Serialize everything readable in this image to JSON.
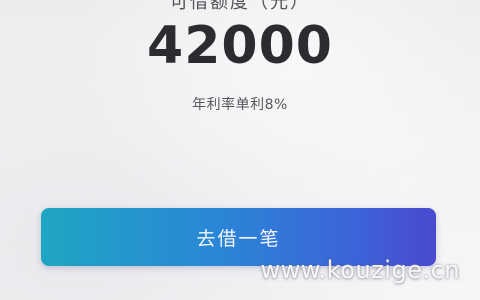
{
  "loan": {
    "amount_label": "可借额度（元）",
    "amount": "42000",
    "rate_text": "年利率单利8%"
  },
  "actions": {
    "borrow_label": "去借一笔"
  },
  "watermark": {
    "text": "www.kouzige.cn"
  },
  "colors": {
    "button_gradient_start": "#1fa6c3",
    "button_gradient_end": "#4a49cf",
    "amount_text": "#2c2b30"
  }
}
